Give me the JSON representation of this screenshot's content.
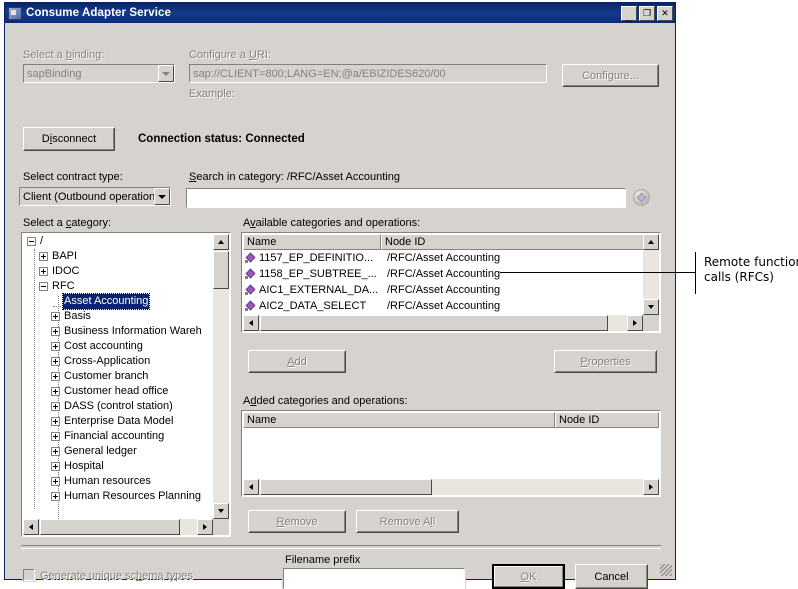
{
  "window": {
    "title": "Consume Adapter Service",
    "icon": "app-icon",
    "minimize": "_",
    "maximize": "❐",
    "close": "✕"
  },
  "binding": {
    "label_pre": "Select a ",
    "label_key": "b",
    "label_post": "inding:",
    "value": "sapBinding",
    "enabled": false
  },
  "uri": {
    "label_pre": "Configure a ",
    "label_key": "U",
    "label_post": "RI:",
    "value": "sap://CLIENT=800;LANG=EN;@a/EBIZIDES620/00",
    "example_label": "Example:",
    "example_value": "",
    "configure_button": "Configure...",
    "configure_enabled": false
  },
  "connection": {
    "disconnect_button": "Disconnect",
    "status_text": "Connection status: Connected"
  },
  "contract": {
    "label": "Select contract type:",
    "value": "Client (Outbound operation)"
  },
  "search": {
    "label": "Search in category: /RFC/Asset Accounting",
    "value": "",
    "placeholder": "",
    "icon": "search-globe-icon"
  },
  "category_tree": {
    "label": "Select a category:",
    "nodes": [
      {
        "label": "/",
        "depth": 0,
        "state": "minus",
        "selected": false
      },
      {
        "label": "BAPI",
        "depth": 1,
        "state": "plus",
        "selected": false
      },
      {
        "label": "IDOC",
        "depth": 1,
        "state": "plus",
        "selected": false
      },
      {
        "label": "RFC",
        "depth": 1,
        "state": "minus",
        "selected": false
      },
      {
        "label": "Asset Accounting",
        "depth": 2,
        "state": "leaf",
        "selected": true
      },
      {
        "label": "Basis",
        "depth": 2,
        "state": "plus",
        "selected": false
      },
      {
        "label": "Business Information Wareh",
        "depth": 2,
        "state": "plus",
        "selected": false
      },
      {
        "label": "Cost accounting",
        "depth": 2,
        "state": "plus",
        "selected": false
      },
      {
        "label": "Cross-Application",
        "depth": 2,
        "state": "plus",
        "selected": false
      },
      {
        "label": "Customer branch",
        "depth": 2,
        "state": "plus",
        "selected": false
      },
      {
        "label": "Customer head office",
        "depth": 2,
        "state": "plus",
        "selected": false
      },
      {
        "label": "DASS (control station)",
        "depth": 2,
        "state": "plus",
        "selected": false
      },
      {
        "label": "Enterprise Data Model",
        "depth": 2,
        "state": "plus",
        "selected": false
      },
      {
        "label": "Financial accounting",
        "depth": 2,
        "state": "plus",
        "selected": false
      },
      {
        "label": "General ledger",
        "depth": 2,
        "state": "plus",
        "selected": false
      },
      {
        "label": "Hospital",
        "depth": 2,
        "state": "plus",
        "selected": false
      },
      {
        "label": "Human resources",
        "depth": 2,
        "state": "plus",
        "selected": false
      },
      {
        "label": "Human Resources Planning",
        "depth": 2,
        "state": "plus",
        "selected": false
      }
    ]
  },
  "available": {
    "label": "Available categories and operations:",
    "columns": [
      "Name",
      "Node ID"
    ],
    "rows": [
      {
        "name": "1157_EP_DEFINITIO...",
        "node": "/RFC/Asset Accounting"
      },
      {
        "name": "1158_EP_SUBTREE_...",
        "node": "/RFC/Asset Accounting"
      },
      {
        "name": "AIC1_EXTERNAL_DA...",
        "node": "/RFC/Asset Accounting"
      },
      {
        "name": "AIC2_DATA_SELECT",
        "node": "/RFC/Asset Accounting"
      }
    ]
  },
  "actions": {
    "add": "Add",
    "properties": "Properties",
    "remove": "Remove",
    "remove_all": "Remove All"
  },
  "added": {
    "label": "Added categories and operations:",
    "columns": [
      "Name",
      "Node ID"
    ],
    "rows": []
  },
  "footer": {
    "checkbox_label": "Generate unique schema types",
    "checkbox_checked": false,
    "filename_prefix_label": "Filename prefix",
    "filename_prefix_value": "",
    "ok": "OK",
    "cancel": "Cancel"
  },
  "annotation": {
    "line1": "Remote function",
    "line2": "calls (RFCs)"
  },
  "colors": {
    "dialog_face": "#d6d3ce",
    "titlebar": "#0a246a",
    "selection": "#0a246a",
    "disabled_text": "#85827c",
    "icon_purple": "#9b59b6"
  }
}
